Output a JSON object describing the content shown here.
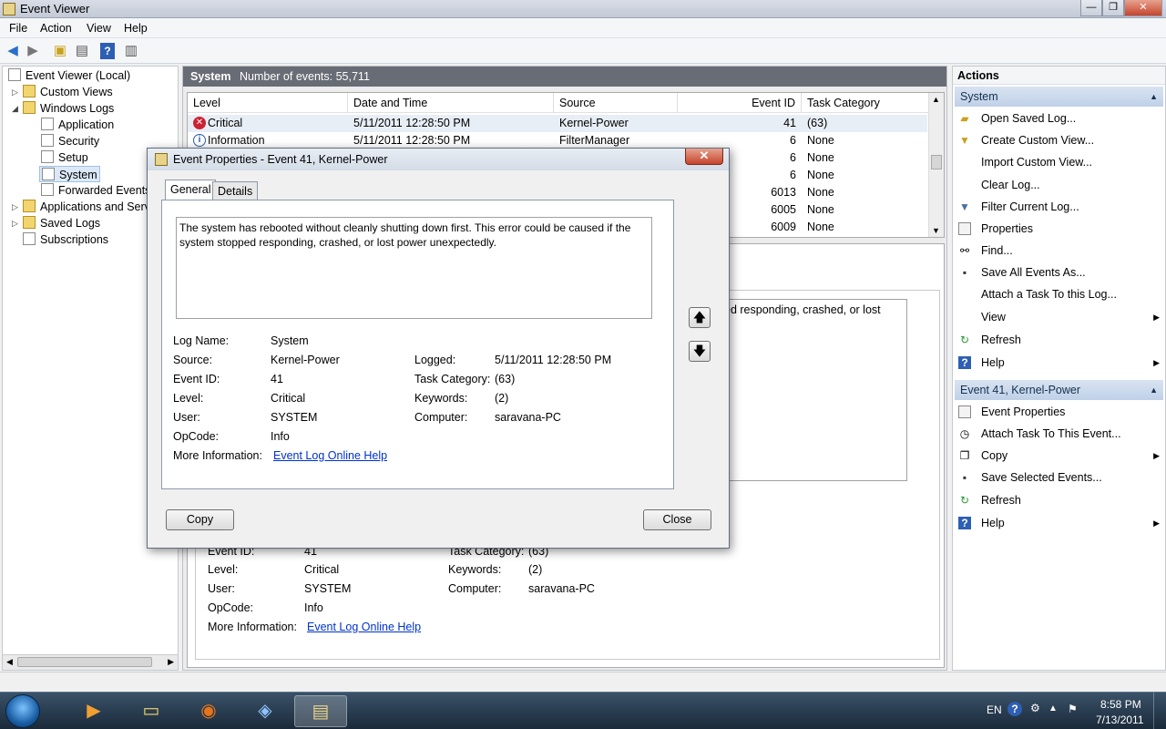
{
  "window": {
    "title": "Event Viewer",
    "min": "—",
    "max": "❐",
    "close": "✕"
  },
  "menu": [
    "File",
    "Action",
    "View",
    "Help"
  ],
  "tree": {
    "root": "Event Viewer (Local)",
    "custom_views": "Custom Views",
    "windows_logs": "Windows Logs",
    "application": "Application",
    "security": "Security",
    "setup": "Setup",
    "system": "System",
    "forwarded": "Forwarded Events",
    "apps_services": "Applications and Servi",
    "saved_logs": "Saved Logs",
    "subscriptions": "Subscriptions"
  },
  "center": {
    "log_name": "System",
    "count_text": "Number of events: 55,711"
  },
  "table": {
    "columns": [
      "Level",
      "Date and Time",
      "Source",
      "Event ID",
      "Task Category"
    ],
    "rows": [
      {
        "level": "Critical",
        "datetime": "5/11/2011 12:28:50 PM",
        "source": "Kernel-Power",
        "id": "41",
        "task": "(63)"
      },
      {
        "level": "Information",
        "datetime": "5/11/2011 12:28:50 PM",
        "source": "FilterManager",
        "id": "6",
        "task": "None"
      },
      {
        "level": "",
        "datetime": "",
        "source": "",
        "id": "6",
        "task": "None"
      },
      {
        "level": "",
        "datetime": "",
        "source": "",
        "id": "6",
        "task": "None"
      },
      {
        "level": "",
        "datetime": "",
        "source": "",
        "id": "6013",
        "task": "None"
      },
      {
        "level": "",
        "datetime": "",
        "source": "",
        "id": "6005",
        "task": "None"
      },
      {
        "level": "",
        "datetime": "",
        "source": "",
        "id": "6009",
        "task": "None"
      }
    ]
  },
  "detail": {
    "partial_desc": "ed responding, crashed, or lost",
    "event_id_label": "Event ID:",
    "event_id": "41",
    "task_label": "Task Category:",
    "task": "(63)",
    "level_label": "Level:",
    "level": "Critical",
    "keywords_label": "Keywords:",
    "keywords": "(2)",
    "user_label": "User:",
    "user": "SYSTEM",
    "computer_label": "Computer:",
    "computer": "saravana-PC",
    "opcode_label": "OpCode:",
    "opcode": "Info",
    "moreinfo_label": "More Information:",
    "link": "Event Log Online Help"
  },
  "actions": {
    "header": "Actions",
    "section1": "System",
    "items1": [
      "Open Saved Log...",
      "Create Custom View...",
      "Import Custom View...",
      "Clear Log...",
      "Filter Current Log...",
      "Properties",
      "Find...",
      "Save All Events As...",
      "Attach a Task To this Log...",
      "View",
      "Refresh",
      "Help"
    ],
    "section2": "Event 41, Kernel-Power",
    "items2": [
      "Event Properties",
      "Attach Task To This Event...",
      "Copy",
      "Save Selected Events...",
      "Refresh",
      "Help"
    ]
  },
  "dialog": {
    "title": "Event Properties - Event 41, Kernel-Power",
    "tab_general": "General",
    "tab_details": "Details",
    "description": "The system has rebooted without cleanly shutting down first. This error could be caused if the system stopped responding, crashed, or lost power unexpectedly.",
    "log_name_label": "Log Name:",
    "log_name": "System",
    "source_label": "Source:",
    "source": "Kernel-Power",
    "logged_label": "Logged:",
    "logged": "5/11/2011 12:28:50 PM",
    "event_id_label": "Event ID:",
    "event_id": "41",
    "task_label": "Task Category:",
    "task": "(63)",
    "level_label": "Level:",
    "level": "Critical",
    "keywords_label": "Keywords:",
    "keywords": "(2)",
    "user_label": "User:",
    "user": "SYSTEM",
    "computer_label": "Computer:",
    "computer": "saravana-PC",
    "opcode_label": "OpCode:",
    "opcode": "Info",
    "moreinfo_label": "More Information:",
    "link": "Event Log Online Help",
    "copy_btn": "Copy",
    "close_btn": "Close"
  },
  "tray": {
    "lang": "EN",
    "time": "8:58 PM",
    "date": "7/13/2011"
  }
}
